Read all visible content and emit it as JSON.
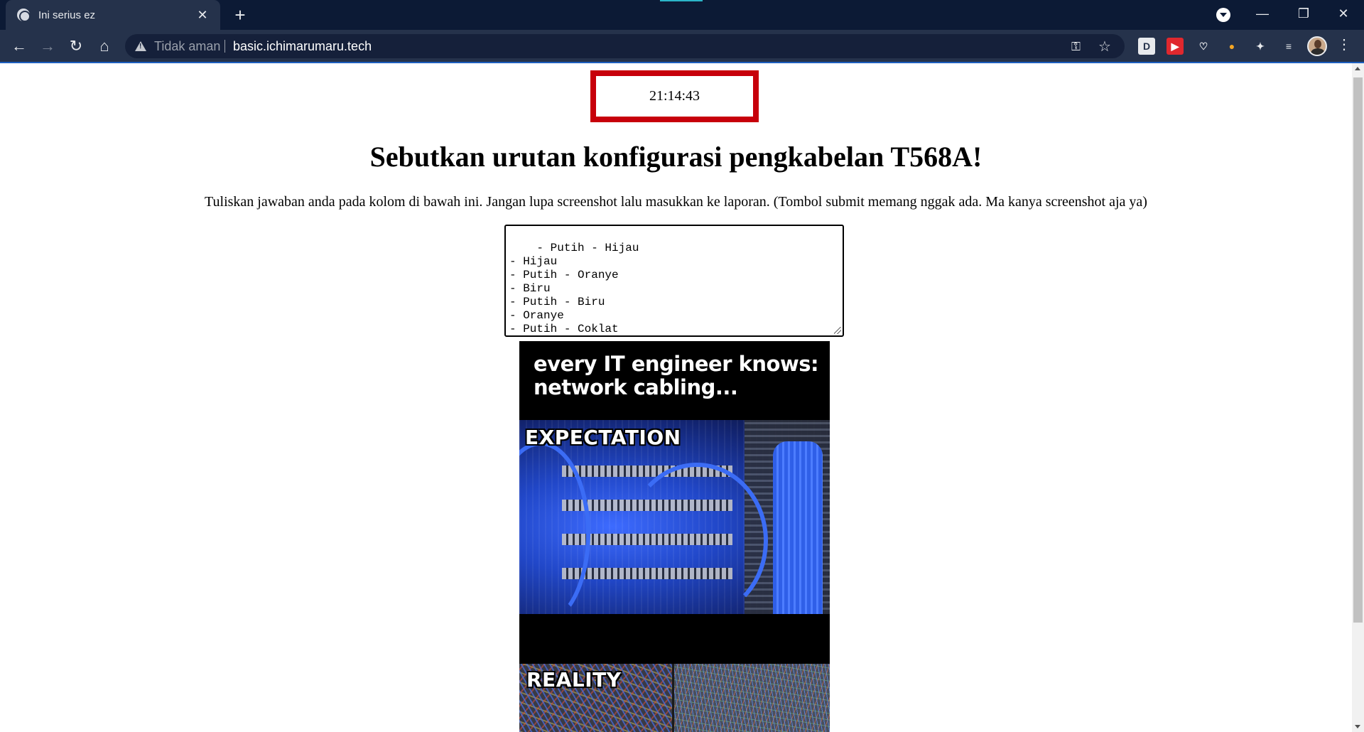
{
  "browser": {
    "tab": {
      "title": "Ini serius ez",
      "favicon": "globe-icon",
      "close_glyph": "✕"
    },
    "new_tab_glyph": "+",
    "window_controls": {
      "minimize": "—",
      "maximize": "❐",
      "close": "✕"
    },
    "nav": {
      "back": "←",
      "forward": "→",
      "reload": "↻",
      "home": "⌂"
    },
    "address_bar": {
      "security_label": "Tidak aman",
      "url": "basic.ichimarumaru.tech"
    },
    "toolbar_icons": {
      "key": "⚿",
      "star": "☆",
      "extensions": [
        {
          "name": "d-extension-icon",
          "glyph": "D",
          "bg": "#e8eaed",
          "fg": "#25324b"
        },
        {
          "name": "red-extension-icon",
          "glyph": "▶",
          "bg": "#e0282e",
          "fg": "#ffffff"
        },
        {
          "name": "pocket-icon",
          "glyph": "♡",
          "bg": "transparent",
          "fg": "#e8eaed"
        },
        {
          "name": "orange-extension-icon",
          "glyph": "●",
          "bg": "transparent",
          "fg": "#f5a623"
        },
        {
          "name": "puzzle-icon",
          "glyph": "✦",
          "bg": "transparent",
          "fg": "#e8eaed"
        },
        {
          "name": "reading-list-icon",
          "glyph": "≡",
          "bg": "transparent",
          "fg": "#e8eaed"
        }
      ],
      "menu": "⋮"
    }
  },
  "page": {
    "clock": "21:14:43",
    "question": "Sebutkan urutan konfigurasi pengkabelan T568A!",
    "instruction": "Tuliskan jawaban anda pada kolom di bawah ini. Jangan lupa screenshot lalu masukkan ke laporan. (Tombol submit memang nggak ada. Ma kanya screenshot aja ya)",
    "answer": "- Putih - Hijau\n- Hijau\n- Putih - Oranye\n- Biru\n- Putih - Biru\n- Oranye\n- Putih - Coklat\n- Coklat",
    "meme": {
      "caption_line1": "every IT engineer knows:",
      "caption_line2": "network cabling...",
      "label_expectation": "EXPECTATION",
      "label_reality": "REALITY"
    }
  },
  "colors": {
    "clock_border": "#c7000b",
    "browser_frame": "#0c1a35",
    "toolbar": "#25324b"
  }
}
